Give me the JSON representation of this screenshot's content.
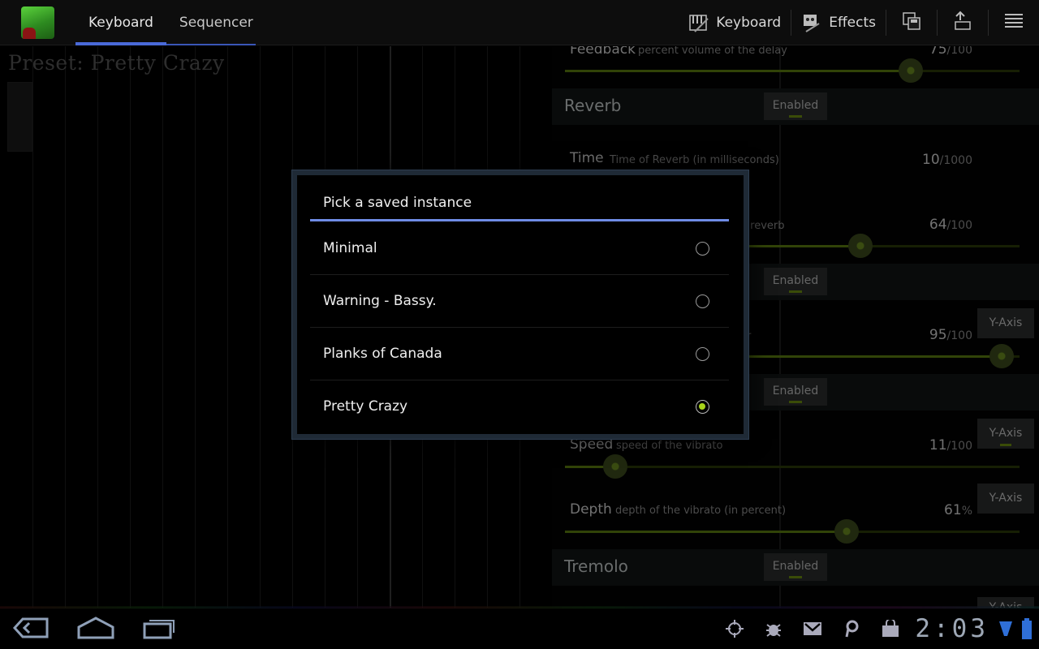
{
  "actionbar": {
    "tabs": [
      {
        "label": "Keyboard",
        "selected": true
      },
      {
        "label": "Sequencer",
        "selected": false
      }
    ],
    "keyboard_label": "Keyboard",
    "effects_label": "Effects",
    "icons": [
      "piano-icon",
      "effects-icon",
      "save-icon",
      "upload-icon",
      "overflow-menu-icon"
    ]
  },
  "keyboard": {
    "preset_label": "Preset: Pretty Crazy"
  },
  "effects": {
    "delay": {
      "feedback": {
        "name": "Feedback",
        "desc": "percent volume of the delay",
        "value": "75",
        "max": "/100",
        "level": 0.76
      }
    },
    "reverb": {
      "title": "Reverb",
      "enabled_label": "Enabled",
      "time": {
        "name": "Time",
        "desc": "Time of Reverb (in milliseconds)",
        "value": "10",
        "max": "/1000",
        "level": 0.01
      },
      "amount": {
        "desc": "e reverb",
        "value": "64",
        "max": "/100",
        "level": 0.65
      }
    },
    "section3": {
      "enabled_label": "Enabled",
      "param": {
        "desc": "er",
        "value": "95",
        "max": "/100",
        "level": 0.96
      },
      "yaxis_label": "Y-Axis"
    },
    "vibrato": {
      "enabled_label": "Enabled",
      "speed": {
        "name": "Speed",
        "desc": "speed of the vibrato",
        "value": "11",
        "max": "/100",
        "level": 0.11
      },
      "depth": {
        "name": "Depth",
        "desc": "depth of the vibrato (in percent)",
        "value": "61",
        "max": "%",
        "level": 0.62
      },
      "yaxis_label": "Y-Axis"
    },
    "tremolo": {
      "title": "Tremolo",
      "enabled_label": "Enabled",
      "yaxis_label": "Y-Axis"
    }
  },
  "dialog": {
    "title": "Pick a saved instance",
    "items": [
      {
        "label": "Minimal",
        "checked": false
      },
      {
        "label": "Warning - Bassy.",
        "checked": false
      },
      {
        "label": "Planks of Canada",
        "checked": false
      },
      {
        "label": "Pretty Crazy",
        "checked": true
      }
    ]
  },
  "sysbar": {
    "time": "2:03",
    "icons": [
      "back-icon",
      "home-icon",
      "recent-apps-icon",
      "gps-icon",
      "debug-icon",
      "gmail-icon",
      "p-icon",
      "market-icon",
      "signal-icon",
      "battery-icon"
    ]
  },
  "colors": {
    "accent_blue": "#4a6ad8",
    "slider_green": "#5a7a10",
    "radio_green": "#a8d41a"
  }
}
